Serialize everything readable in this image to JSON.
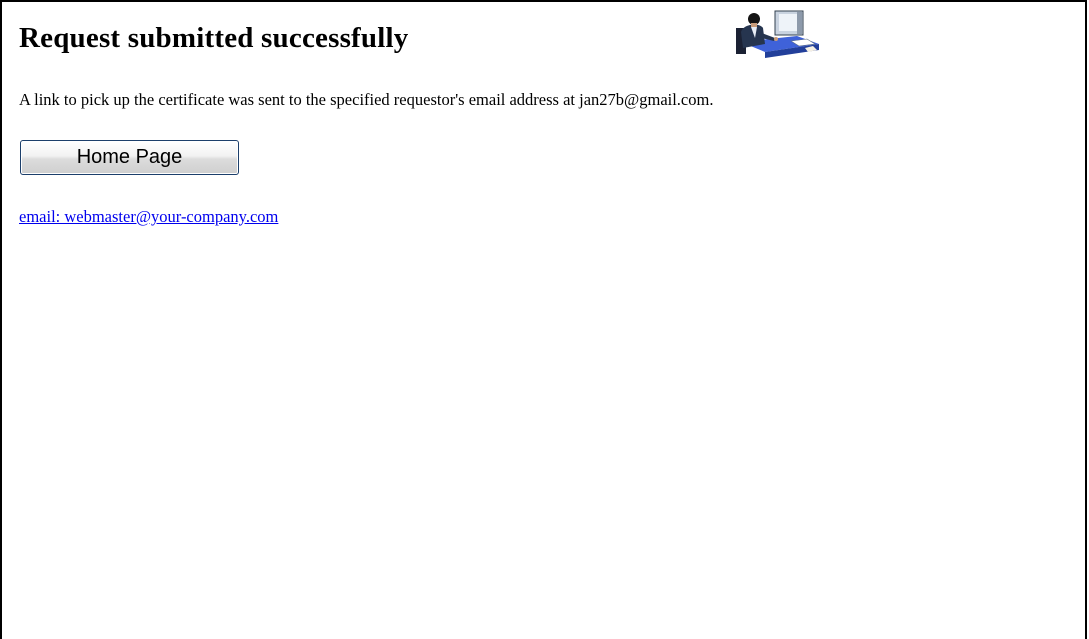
{
  "page": {
    "title": "Request submitted successfully",
    "message": "A link to pick up the certificate was sent to the specified requestor's email address at jan27b@gmail.com.",
    "home_button_label": "Home Page",
    "contact_link_text": "email: webmaster@your-company.com"
  },
  "illustration": {
    "icon": "person-at-computer-icon"
  },
  "colors": {
    "link": "#0000ee",
    "button_border": "#1c3f6b",
    "text": "#000000",
    "background": "#ffffff"
  }
}
